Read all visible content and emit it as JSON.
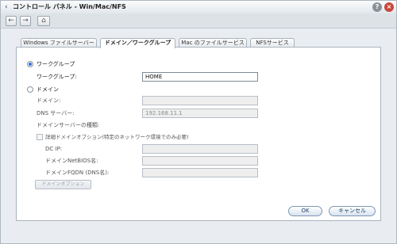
{
  "titlebar": {
    "back_glyph": "‹",
    "title": "コントロール パネル - Win/Mac/NFS",
    "help_glyph": "?",
    "close_glyph": "×"
  },
  "navbar": {
    "back_glyph": "←",
    "forward_glyph": "→",
    "home_glyph": "⌂"
  },
  "tabs": [
    {
      "label": "Windows ファイルサーバー",
      "active": false
    },
    {
      "label": "ドメイン／ワークグループ",
      "active": true
    },
    {
      "label": "Mac のファイルサービス",
      "active": false
    },
    {
      "label": "NFSサービス",
      "active": false
    }
  ],
  "workgroup": {
    "radio_label": "ワークグループ",
    "selected": true,
    "field_label": "ワークグループ:",
    "field_value": "HOME"
  },
  "domain": {
    "radio_label": "ドメイン",
    "selected": false,
    "domain_label": "ドメイン:",
    "domain_value": "",
    "dns_label": "DNS サーバー:",
    "dns_value": "192.168.11.1",
    "server_type_label": "ドメインサーバーの種類:",
    "advanced_label": "詳細ドメインオプション(特定のネットワーク環境でのみ必要)",
    "advanced_checked": false,
    "dc_ip_label": "DC IP:",
    "dc_ip_value": "",
    "netbios_label": "ドメインNetBIOS名:",
    "netbios_value": "",
    "fqdn_label": "ドメインFQDN (DNS名):",
    "fqdn_value": "",
    "options_button": "ドメインオプション"
  },
  "footer": {
    "ok_label": "OK",
    "cancel_label": "キャンセル"
  },
  "colors": {
    "window_bg": "#e9edf1",
    "accent": "#2a6fd6",
    "close_red": "#c8463a"
  }
}
